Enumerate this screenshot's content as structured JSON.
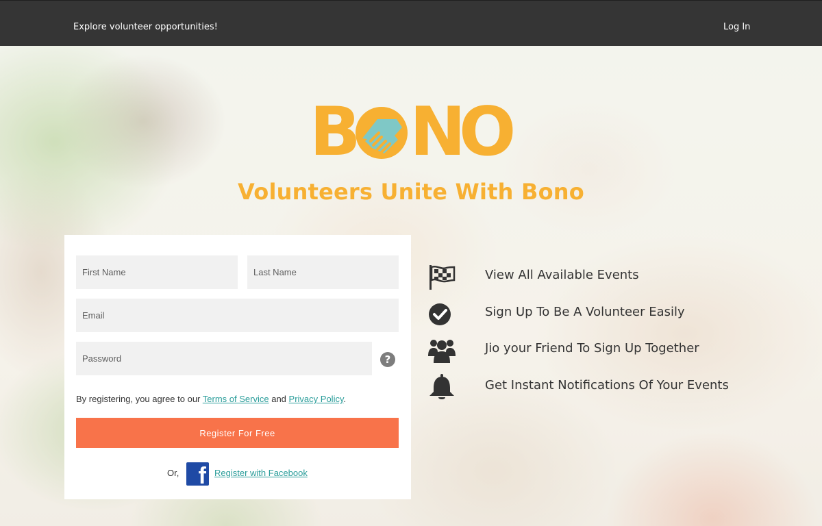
{
  "topbar": {
    "explore_label": "Explore volunteer opportunities!",
    "login_label": "Log In"
  },
  "logo": {
    "letters": [
      "B",
      "N",
      "O"
    ],
    "brand_color": "#f7b032",
    "accent_color": "#7fc8c6"
  },
  "tagline": "Volunteers Unite With Bono",
  "form": {
    "first_name_placeholder": "First Name",
    "last_name_placeholder": "Last Name",
    "email_placeholder": "Email",
    "password_placeholder": "Password",
    "help_icon": "?",
    "terms_prefix": "By registering, you agree to our",
    "terms_link": "Terms of Service",
    "terms_and": "and",
    "privacy_link": "Privacy Policy",
    "terms_suffix": ".",
    "register_label": "Register For Free",
    "or_label": "Or,",
    "facebook_glyph": "f",
    "facebook_label": "Register with Facebook",
    "button_color": "#f8734a",
    "link_color": "#2a9d9a",
    "facebook_color": "#1f4aa5"
  },
  "features": [
    {
      "icon": "checkered-flag-icon",
      "label": "View All Available Events"
    },
    {
      "icon": "check-circle-icon",
      "label": "Sign Up To Be A Volunteer Easily"
    },
    {
      "icon": "group-icon",
      "label": "Jio your Friend To Sign Up Together"
    },
    {
      "icon": "bell-icon",
      "label": "Get Instant Notifications Of Your Events"
    }
  ]
}
